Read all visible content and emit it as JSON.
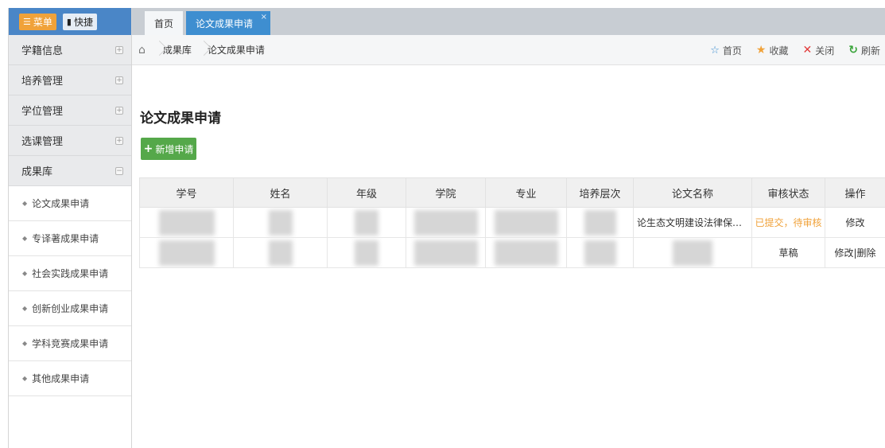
{
  "sidebar": {
    "menu_label": "菜单",
    "quick_label": "快捷",
    "groups": [
      {
        "label": "学籍信息"
      },
      {
        "label": "培养管理"
      },
      {
        "label": "学位管理"
      },
      {
        "label": "选课管理"
      },
      {
        "label": "成果库"
      }
    ],
    "items": [
      {
        "label": "论文成果申请"
      },
      {
        "label": "专译著成果申请"
      },
      {
        "label": "社会实践成果申请"
      },
      {
        "label": "创新创业成果申请"
      },
      {
        "label": "学科竞赛成果申请"
      },
      {
        "label": "其他成果申请"
      }
    ]
  },
  "tabs": [
    {
      "label": "首页"
    },
    {
      "label": "论文成果申请",
      "close": "×"
    }
  ],
  "breadcrumb": [
    "成果库",
    "论文成果申请"
  ],
  "actions": {
    "home": "首页",
    "favorite": "收藏",
    "close": "关闭",
    "refresh": "刷新"
  },
  "page": {
    "title": "论文成果申请",
    "add_button": "新增申请"
  },
  "table": {
    "columns": [
      "学号",
      "姓名",
      "年级",
      "学院",
      "专业",
      "培养层次",
      "论文名称",
      "审核状态",
      "操作"
    ],
    "rows": [
      {
        "thesis": "论生态文明建设法律保障体...",
        "status": "已提交，待审核",
        "actions": [
          "修改"
        ]
      },
      {
        "thesis": "",
        "status": "草稿",
        "actions": [
          "修改|",
          "删除"
        ]
      }
    ]
  },
  "colors": {
    "accent_blue": "#3e8ed0",
    "menu_orange": "#f0a23a",
    "add_green": "#55a84a",
    "pending_orange": "#f0a23a",
    "close_red": "#e23a3a"
  }
}
